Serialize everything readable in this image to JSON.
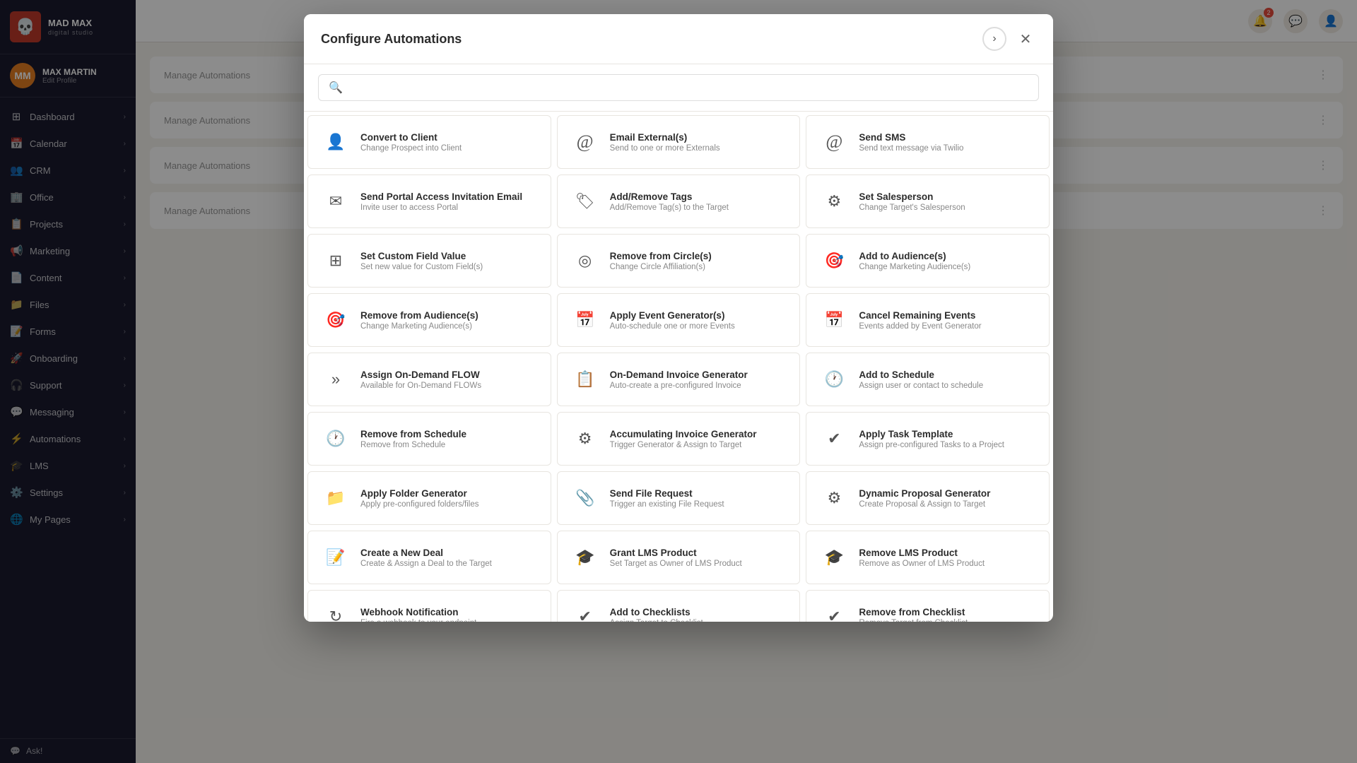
{
  "app": {
    "logo_name": "MAD MAX",
    "logo_sub": "digital studio",
    "logo_icon": "💀"
  },
  "user": {
    "name": "MAX MARTIN",
    "edit_label": "Edit Profile",
    "initials": "MM"
  },
  "sidebar": {
    "items": [
      {
        "id": "dashboard",
        "label": "Dashboard",
        "icon": "⊞",
        "has_arrow": true
      },
      {
        "id": "calendar",
        "label": "Calendar",
        "icon": "📅",
        "has_arrow": true
      },
      {
        "id": "crm",
        "label": "CRM",
        "icon": "👥",
        "has_arrow": true
      },
      {
        "id": "office",
        "label": "Office",
        "icon": "🏢",
        "has_arrow": true
      },
      {
        "id": "projects",
        "label": "Projects",
        "icon": "📋",
        "has_arrow": true
      },
      {
        "id": "marketing",
        "label": "Marketing",
        "icon": "📢",
        "has_arrow": true
      },
      {
        "id": "content",
        "label": "Content",
        "icon": "📄",
        "has_arrow": true
      },
      {
        "id": "files",
        "label": "Files",
        "icon": "📁",
        "has_arrow": true
      },
      {
        "id": "forms",
        "label": "Forms",
        "icon": "📝",
        "has_arrow": true
      },
      {
        "id": "onboarding",
        "label": "Onboarding",
        "icon": "🚀",
        "has_arrow": true
      },
      {
        "id": "support",
        "label": "Support",
        "icon": "🎧",
        "has_arrow": true
      },
      {
        "id": "messaging",
        "label": "Messaging",
        "icon": "💬",
        "has_arrow": true
      },
      {
        "id": "automations",
        "label": "Automations",
        "icon": "⚡",
        "has_arrow": true
      },
      {
        "id": "lms",
        "label": "LMS",
        "icon": "🎓",
        "has_arrow": true
      },
      {
        "id": "settings",
        "label": "Settings",
        "icon": "⚙️",
        "has_arrow": true
      },
      {
        "id": "mypages",
        "label": "My Pages",
        "icon": "🌐",
        "has_arrow": true
      }
    ],
    "footer": {
      "ask_label": "Ask!"
    }
  },
  "topbar": {
    "notification_count": "2"
  },
  "modal": {
    "title": "Configure Automations",
    "search_placeholder": "",
    "close_label": "×",
    "back_label": "‹",
    "automations": [
      {
        "id": "convert-to-client",
        "title": "Convert to Client",
        "desc": "Change Prospect into Client",
        "icon": "👤"
      },
      {
        "id": "email-externals",
        "title": "Email External(s)",
        "desc": "Send to one or more Externals",
        "icon": "@"
      },
      {
        "id": "send-sms",
        "title": "Send SMS",
        "desc": "Send text message via Twilio",
        "icon": "@"
      },
      {
        "id": "send-portal-email",
        "title": "Send Portal Access Invitation Email",
        "desc": "Invite user to access Portal",
        "icon": "✉"
      },
      {
        "id": "add-remove-tags",
        "title": "Add/Remove Tags",
        "desc": "Add/Remove Tag(s) to the Target",
        "icon": "🏷"
      },
      {
        "id": "set-salesperson",
        "title": "Set Salesperson",
        "desc": "Change Target's Salesperson",
        "icon": "⚙"
      },
      {
        "id": "set-custom-field",
        "title": "Set Custom Field Value",
        "desc": "Set new value for Custom Field(s)",
        "icon": "⊞"
      },
      {
        "id": "remove-from-circle",
        "title": "Remove from Circle(s)",
        "desc": "Change Circle Affiliation(s)",
        "icon": "◎"
      },
      {
        "id": "add-to-audiences",
        "title": "Add to Audience(s)",
        "desc": "Change Marketing Audience(s)",
        "icon": "🎯"
      },
      {
        "id": "remove-from-audiences",
        "title": "Remove from Audience(s)",
        "desc": "Change Marketing Audience(s)",
        "icon": "🎯"
      },
      {
        "id": "apply-event-generator",
        "title": "Apply Event Generator(s)",
        "desc": "Auto-schedule one or more Events",
        "icon": "📅"
      },
      {
        "id": "cancel-remaining-events",
        "title": "Cancel Remaining Events",
        "desc": "Events added by Event Generator",
        "icon": "📅"
      },
      {
        "id": "assign-on-demand-flow",
        "title": "Assign On-Demand FLOW",
        "desc": "Available for On-Demand FLOWs",
        "icon": "»"
      },
      {
        "id": "on-demand-invoice",
        "title": "On-Demand Invoice Generator",
        "desc": "Auto-create a pre-configured Invoice",
        "icon": "📋"
      },
      {
        "id": "add-to-schedule",
        "title": "Add to Schedule",
        "desc": "Assign user or contact to schedule",
        "icon": "🕐"
      },
      {
        "id": "remove-from-schedule",
        "title": "Remove from Schedule",
        "desc": "Remove from Schedule",
        "icon": "🕐"
      },
      {
        "id": "accumulating-invoice",
        "title": "Accumulating Invoice Generator",
        "desc": "Trigger Generator & Assign to Target",
        "icon": "⚙"
      },
      {
        "id": "apply-task-template",
        "title": "Apply Task Template",
        "desc": "Assign pre-configured Tasks to a Project",
        "icon": "✔"
      },
      {
        "id": "apply-folder-generator",
        "title": "Apply Folder Generator",
        "desc": "Apply pre-configured folders/files",
        "icon": "📁"
      },
      {
        "id": "send-file-request",
        "title": "Send File Request",
        "desc": "Trigger an existing File Request",
        "icon": "📎"
      },
      {
        "id": "dynamic-proposal",
        "title": "Dynamic Proposal Generator",
        "desc": "Create Proposal & Assign to Target",
        "icon": "⚙"
      },
      {
        "id": "create-new-deal",
        "title": "Create a New Deal",
        "desc": "Create & Assign a Deal to the Target",
        "icon": "📝"
      },
      {
        "id": "grant-lms-product",
        "title": "Grant LMS Product",
        "desc": "Set Target as Owner of LMS Product",
        "icon": "🎓"
      },
      {
        "id": "remove-lms-product",
        "title": "Remove LMS Product",
        "desc": "Remove as Owner of LMS Product",
        "icon": "🎓"
      },
      {
        "id": "webhook-notification",
        "title": "Webhook Notification",
        "desc": "Fire a webhook to your endpoint",
        "icon": "⟳"
      },
      {
        "id": "add-to-checklists",
        "title": "Add to Checklists",
        "desc": "Assign Target to Checklist",
        "icon": "✔"
      },
      {
        "id": "remove-from-checklist",
        "title": "Remove from Checklist",
        "desc": "Remove Target from Checklist",
        "icon": "✔"
      }
    ]
  }
}
